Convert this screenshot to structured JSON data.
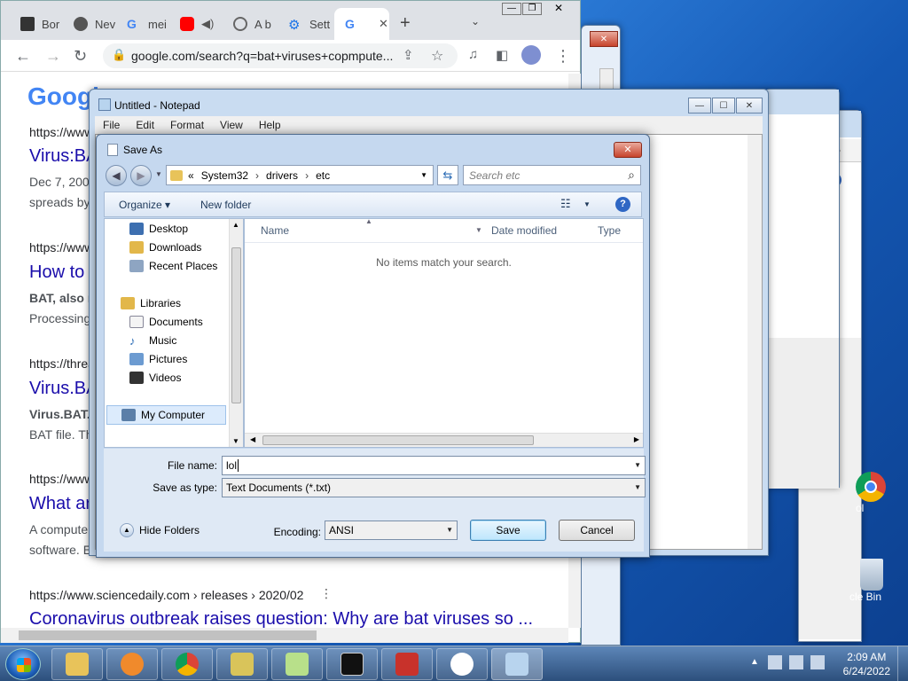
{
  "chrome": {
    "tabs": [
      {
        "label": "Bor",
        "favicon": "museum-icon"
      },
      {
        "label": "Nev",
        "favicon": "chrome-icon"
      },
      {
        "label": "mei",
        "favicon": "google-icon"
      },
      {
        "label": "",
        "favicon": "youtube-icon"
      },
      {
        "label": "A b",
        "favicon": "globe-icon"
      },
      {
        "label": "Sett",
        "favicon": "gear-icon"
      },
      {
        "label": "",
        "favicon": "google-icon"
      }
    ],
    "url": "google.com/search?q=bat+viruses+copmpute...",
    "results": [
      {
        "url": "https://www",
        "title": "Virus:BA",
        "snippet1": "Dec 7, 200",
        "snippet2": "spreads by"
      },
      {
        "url": "https://www",
        "title": "How to",
        "snippet1": "BAT, also n",
        "snippet2": "Processing"
      },
      {
        "url": "https://threa",
        "title": "Virus.BA",
        "snippet1": "Virus.BAT.",
        "snippet2": "BAT file. Th"
      },
      {
        "url": "https://www",
        "title": "What ar",
        "snippet1": "A compute",
        "snippet2": "software. E"
      },
      {
        "url": "https://www.sciencedaily.com › releases › 2020/02",
        "title": "Coronavirus outbreak raises question: Why are bat viruses so ..."
      }
    ]
  },
  "notepad": {
    "title": "Untitled - Notepad",
    "menu": [
      "File",
      "Edit",
      "Format",
      "View",
      "Help"
    ]
  },
  "saveas": {
    "title": "Save As",
    "breadcrumb": [
      "«",
      "System32",
      "drivers",
      "etc"
    ],
    "search_placeholder": "Search etc",
    "organize": "Organize ▾",
    "new_folder": "New folder",
    "nav": {
      "favorites": [
        "Desktop",
        "Downloads",
        "Recent Places"
      ],
      "libraries_label": "Libraries",
      "libraries": [
        "Documents",
        "Music",
        "Pictures",
        "Videos"
      ],
      "computer": "My Computer"
    },
    "columns": [
      "Name",
      "Date modified",
      "Type"
    ],
    "empty_message": "No items match your search.",
    "file_name_label": "File name:",
    "file_name_value": "lol",
    "save_as_type_label": "Save as type:",
    "save_as_type_value": "Text Documents (*.txt)",
    "hide_folders": "Hide Folders",
    "encoding_label": "Encoding:",
    "encoding_value": "ANSI",
    "save": "Save",
    "cancel": "Cancel"
  },
  "desktop": {
    "icons": [
      "ol",
      "cle Bin"
    ]
  },
  "taskbar": {
    "time": "2:09 AM",
    "date": "6/24/2022"
  },
  "colors": {
    "chrome_link": "#1a0dab",
    "aero": "#c5d8ef",
    "taskbar": "#2c4f7c"
  }
}
